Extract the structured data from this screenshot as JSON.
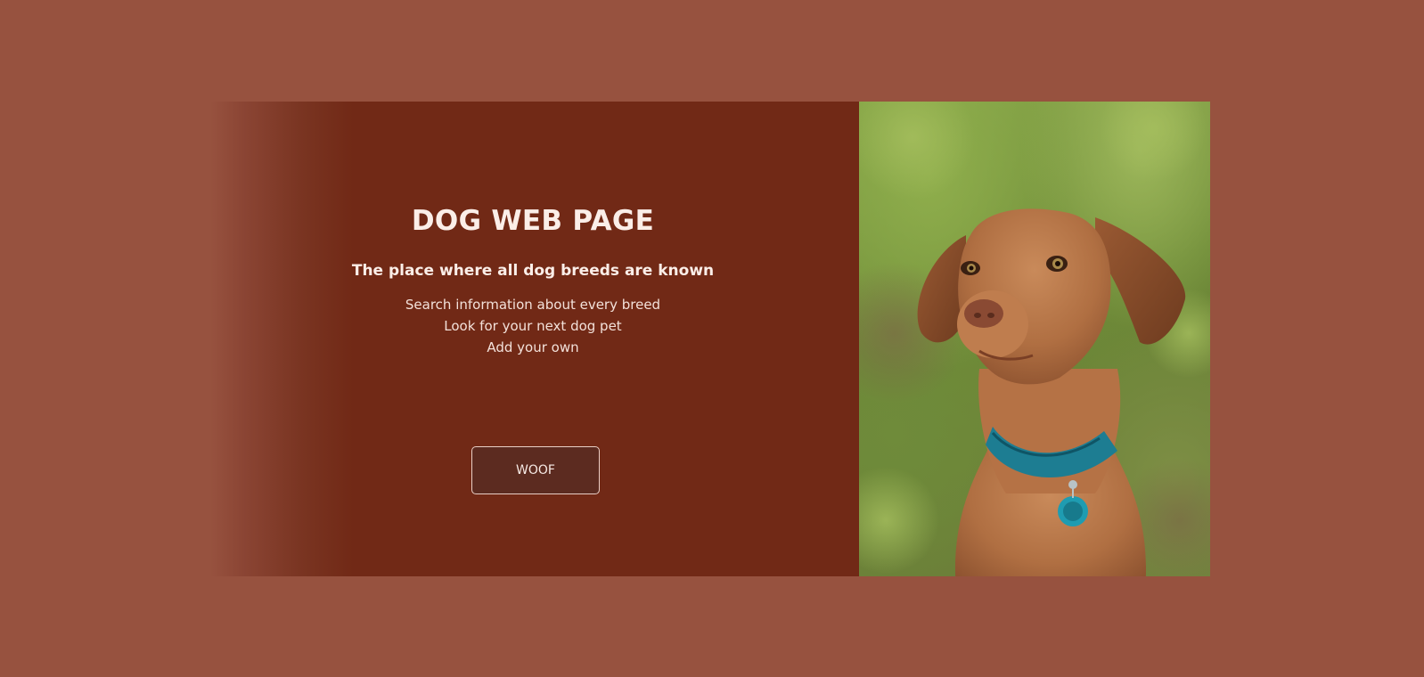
{
  "hero": {
    "title": "DOG WEB PAGE",
    "subtitle": "The place where all dog breeds are known",
    "features": [
      "Search information about every breed",
      "Look for your next dog pet",
      "Add your own"
    ],
    "button_label": "WOOF"
  },
  "photo": {
    "subject": "dog-photo"
  },
  "colors": {
    "page_background": "#97523f",
    "panel_background": "#712916",
    "button_background": "#5c2b20",
    "text": "#fbeee8"
  }
}
